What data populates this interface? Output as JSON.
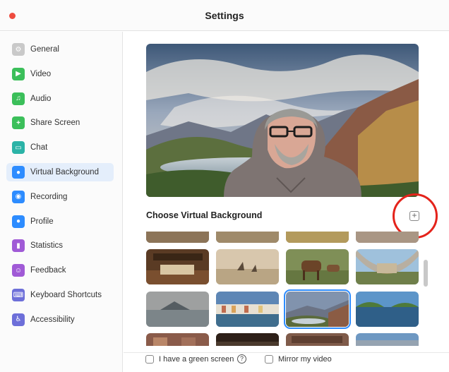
{
  "window": {
    "title": "Settings"
  },
  "sidebar": {
    "items": [
      {
        "label": "General",
        "icon": "gear-icon",
        "color": "#c9c9c9",
        "glyph": "⚙"
      },
      {
        "label": "Video",
        "icon": "video-camera-icon",
        "color": "#3bbf5a",
        "glyph": "▶"
      },
      {
        "label": "Audio",
        "icon": "headphones-icon",
        "color": "#3bbf5a",
        "glyph": "♫"
      },
      {
        "label": "Share Screen",
        "icon": "share-screen-icon",
        "color": "#3bbf5a",
        "glyph": "+"
      },
      {
        "label": "Chat",
        "icon": "chat-icon",
        "color": "#2bb3a7",
        "glyph": "▭"
      },
      {
        "label": "Virtual Background",
        "icon": "person-background-icon",
        "color": "#2d8cff",
        "glyph": "●"
      },
      {
        "label": "Recording",
        "icon": "record-icon",
        "color": "#2d8cff",
        "glyph": "◉"
      },
      {
        "label": "Profile",
        "icon": "profile-icon",
        "color": "#2d8cff",
        "glyph": "●"
      },
      {
        "label": "Statistics",
        "icon": "statistics-icon",
        "color": "#a05ad6",
        "glyph": "▮"
      },
      {
        "label": "Feedback",
        "icon": "feedback-icon",
        "color": "#a05ad6",
        "glyph": "☺"
      },
      {
        "label": "Keyboard Shortcuts",
        "icon": "keyboard-icon",
        "color": "#6d6fd9",
        "glyph": "⌨"
      },
      {
        "label": "Accessibility",
        "icon": "accessibility-icon",
        "color": "#6d6fd9",
        "glyph": "♿"
      }
    ],
    "active_index": 5
  },
  "main": {
    "section_title": "Choose Virtual Background",
    "add_button_glyph": "+",
    "green_screen_label": "I have a green screen",
    "help_glyph": "?",
    "mirror_label": "Mirror my video"
  },
  "colors": {
    "accent": "#2d8cff",
    "highlight_circle": "#e4231b",
    "close_button": "#ee4b3f"
  }
}
